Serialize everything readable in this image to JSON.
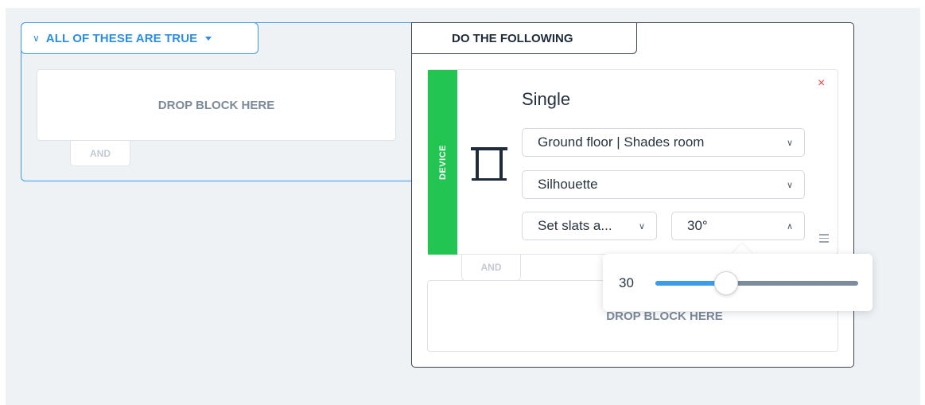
{
  "condition_group": {
    "header_label": "ALL OF THESE ARE TRUE",
    "drop_label": "DROP BLOCK HERE",
    "and_label": "AND"
  },
  "action_group": {
    "header_label": "DO THE FOLLOWING",
    "device_card": {
      "stripe_label": "DEVICE",
      "title": "Single",
      "close_symbol": "×",
      "room_select": "Ground floor | Shades room",
      "device_select": "Silhouette",
      "action_select": "Set slats a...",
      "angle_select": "30°",
      "icon": "window-blind-icon"
    },
    "and_label": "AND",
    "drop_label": "DROP BLOCK HERE"
  },
  "slider_popover": {
    "value_label": "30",
    "level": 0.35
  },
  "colors": {
    "accent_blue": "#2b8de6",
    "device_green": "#22c552",
    "close_red": "#e54343"
  }
}
